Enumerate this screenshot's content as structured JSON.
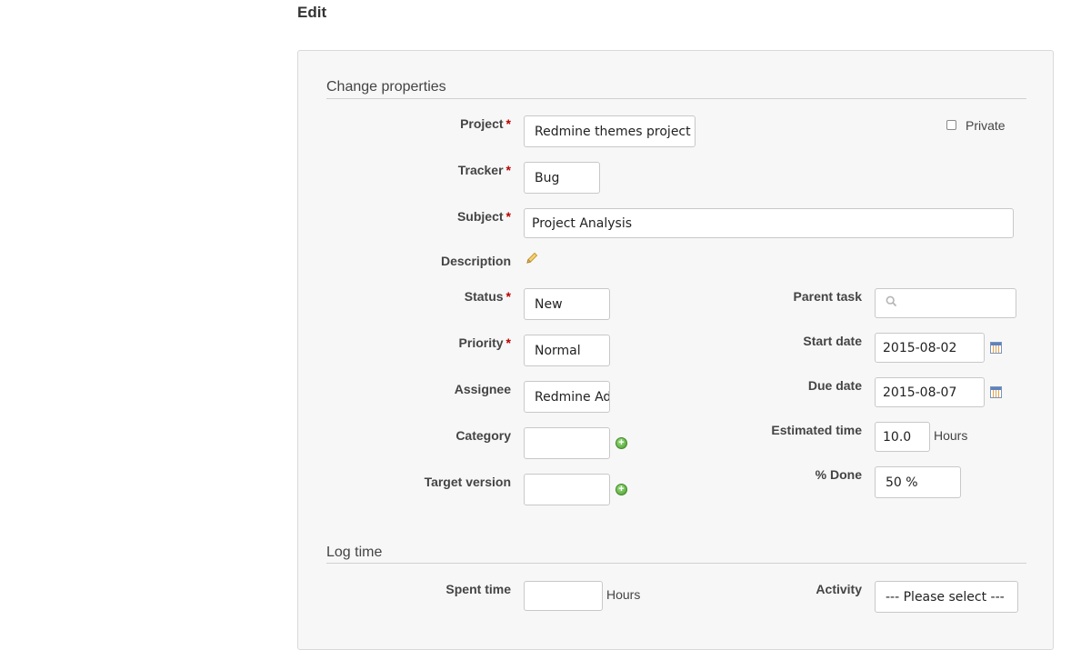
{
  "page": {
    "title": "Edit"
  },
  "properties": {
    "legend": "Change properties",
    "private_label": "Private",
    "project": {
      "label": "Project",
      "required": "*",
      "value": "Redmine themes project"
    },
    "tracker": {
      "label": "Tracker",
      "required": "*",
      "value": "Bug"
    },
    "subject": {
      "label": "Subject",
      "required": "*",
      "value": "Project Analysis"
    },
    "description": {
      "label": "Description"
    },
    "status": {
      "label": "Status",
      "required": "*",
      "value": "New"
    },
    "priority": {
      "label": "Priority",
      "required": "*",
      "value": "Normal"
    },
    "assignee": {
      "label": "Assignee",
      "value": "Redmine Admin"
    },
    "category": {
      "label": "Category",
      "value": ""
    },
    "target_version": {
      "label": "Target version",
      "value": ""
    },
    "parent_task": {
      "label": "Parent task",
      "value": ""
    },
    "start_date": {
      "label": "Start date",
      "value": "2015-08-02"
    },
    "due_date": {
      "label": "Due date",
      "value": "2015-08-07"
    },
    "estimated_time": {
      "label": "Estimated time",
      "value": "10.0",
      "unit": "Hours"
    },
    "done_ratio": {
      "label": "% Done",
      "value": "50 %"
    }
  },
  "log_time": {
    "legend": "Log time",
    "spent_time": {
      "label": "Spent time",
      "value": "",
      "unit": "Hours"
    },
    "activity": {
      "label": "Activity",
      "value": "--- Please select ---"
    }
  },
  "icons": {
    "edit_description": "pencil-icon",
    "add_category": "add-icon",
    "add_version": "add-icon",
    "calendar": "calendar-icon",
    "search": "search-icon"
  },
  "colors": {
    "required": "#bb0000",
    "panel_bg": "#f7f7f7",
    "add_green": "#4a9a2e"
  }
}
